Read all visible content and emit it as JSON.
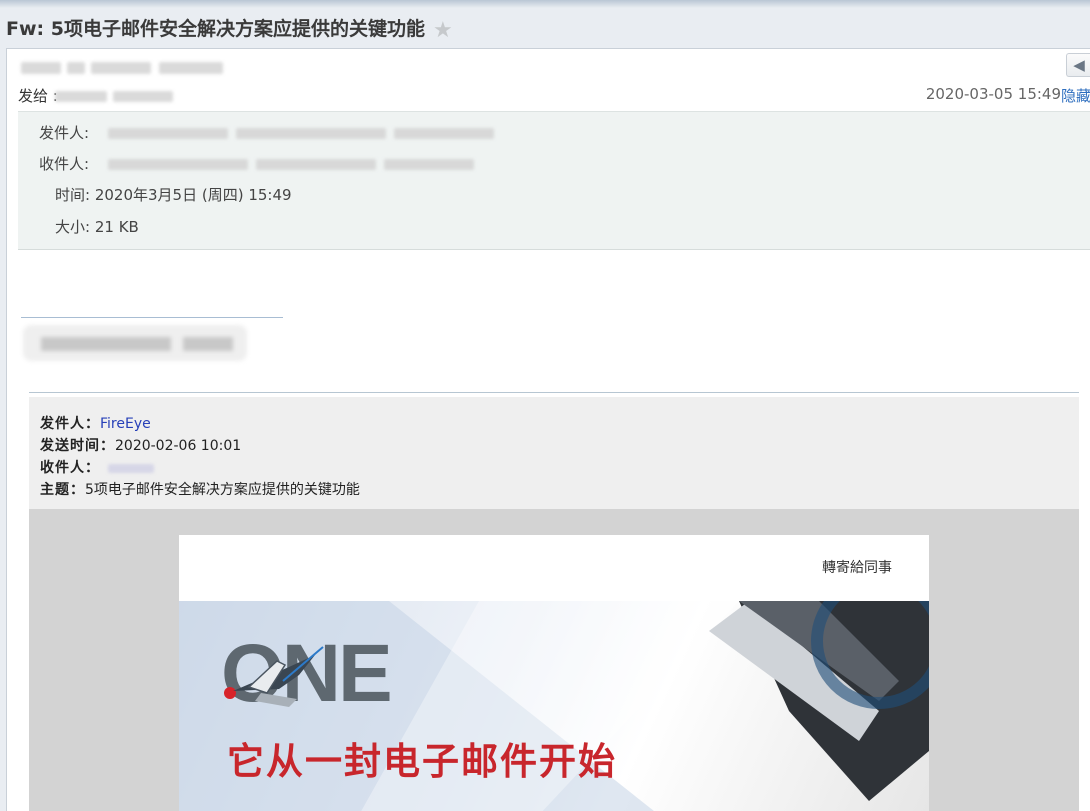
{
  "email": {
    "subject": "Fw: 5项电子邮件安全解决方案应提供的关键功能",
    "star_icon": "star-icon",
    "to_label": "发给 :",
    "datetime": "2020-03-05 15:49",
    "hide_label": "隐藏",
    "back_icon": "reply-arrow-icon"
  },
  "details": {
    "from_label": "发件人:",
    "to_label": "收件人:",
    "time_label": "时间:",
    "time_value": "2020年3月5日 (周四) 15:49",
    "size_label": "大小:",
    "size_value": "21 KB"
  },
  "forwarded": {
    "from_label": "发件人：",
    "from_value": "FireEye",
    "sent_label": "发送时间：",
    "sent_value": "2020-02-06 10:01",
    "to_label": "收件人：",
    "subject_label": "主题：",
    "subject_value": "5项电子邮件安全解决方案应提供的关键功能"
  },
  "newsletter": {
    "forward_link": "轉寄給同事",
    "logo_text": "ONE",
    "tagline": "它从一封电子邮件开始"
  },
  "colors": {
    "accent_link": "#2f6fbf",
    "brand_red": "#c8262c",
    "details_bg": "#eff3f2"
  }
}
